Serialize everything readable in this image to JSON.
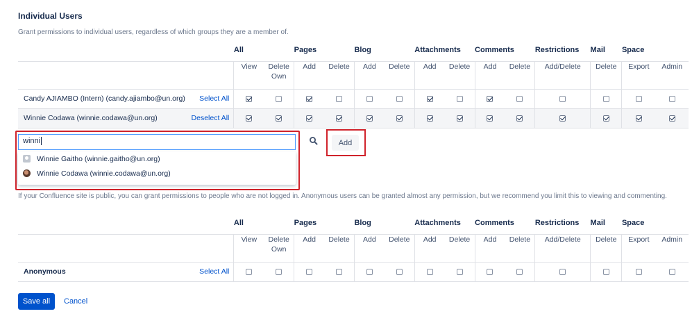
{
  "section": {
    "title": "Individual Users",
    "description": "Grant permissions to individual users, regardless of which groups they are a member of."
  },
  "groups": [
    "All",
    "Pages",
    "Blog",
    "Attachments",
    "Comments",
    "Restrictions",
    "Mail",
    "Space"
  ],
  "columns": {
    "all_view": "View",
    "all_delete_own": "Delete Own",
    "pages_add": "Add",
    "pages_delete": "Delete",
    "blog_add": "Add",
    "blog_delete": "Delete",
    "att_add": "Add",
    "att_delete": "Delete",
    "com_add": "Add",
    "com_delete": "Delete",
    "restrictions": "Add/Delete",
    "mail_delete": "Delete",
    "space_export": "Export",
    "space_admin": "Admin"
  },
  "users": [
    {
      "name": "Candy AJIAMBO (Intern)",
      "email": "(candy.ajiambo@un.org)",
      "action": "Select All",
      "perms": [
        true,
        false,
        true,
        false,
        false,
        false,
        true,
        false,
        true,
        false,
        false,
        false,
        false,
        false
      ]
    },
    {
      "name": "Winnie Codawa",
      "email": "(winnie.codawa@un.org)",
      "action": "Deselect All",
      "perms": [
        true,
        true,
        true,
        true,
        true,
        true,
        true,
        true,
        true,
        true,
        true,
        true,
        true,
        true
      ]
    }
  ],
  "search": {
    "value": "winni",
    "add_label": "Add",
    "suggestions": [
      {
        "label": "Winnie Gaitho (winnie.gaitho@un.org)",
        "avatar": "default-avatar-icon"
      },
      {
        "label": "Winnie Codawa (winnie.codawa@un.org)",
        "avatar": "photo-avatar"
      }
    ]
  },
  "anonymous": {
    "description": "If your Confluence site is public, you can grant permissions to people who are not logged in. Anonymous users can be granted almost any permission, but we recommend you limit this to viewing and commenting.",
    "label": "Anonymous",
    "action": "Select All",
    "perms": [
      false,
      false,
      false,
      false,
      false,
      false,
      false,
      false,
      false,
      false,
      false,
      false,
      false,
      false
    ]
  },
  "footer": {
    "save_label": "Save all",
    "cancel_label": "Cancel"
  },
  "colors": {
    "primary": "#0052cc",
    "highlight_border": "#d0232b",
    "text": "#172b4d",
    "muted": "#6b778c"
  }
}
